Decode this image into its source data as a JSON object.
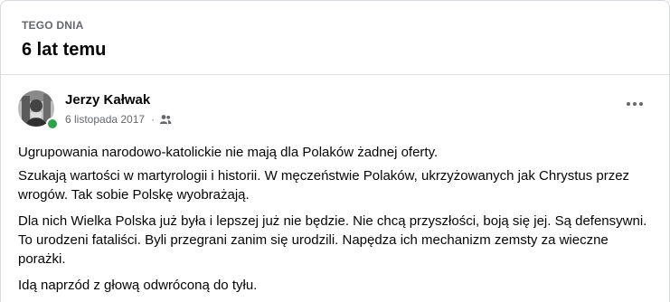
{
  "memory": {
    "kicker": "TEGO DNIA",
    "title": "6 lat temu"
  },
  "post": {
    "author": "Jerzy Kałwak",
    "date": "6 listopada 2017",
    "separator": "·",
    "audience_icon": "friends-icon",
    "more_icon": "more-options-icon",
    "online_color": "#31a24c",
    "paragraphs": [
      "Ugrupowania narodowo-katolickie nie mają dla Polaków żadnej oferty.",
      "Szukają wartości w martyrologii i historii. W męczeństwie Polaków, ukrzyżowanych jak Chrystus przez wrogów. Tak sobie Polskę wyobrażają.",
      "Dla nich Wielka Polska już była i lepszej już nie będzie. Nie chcą przyszłości, boją się jej. Są defensywni. To urodzeni fataliści. Byli przegrani zanim się urodzili. Napędza ich mechanizm zemsty za wieczne porażki.",
      "Idą naprzód z głową odwróconą do tyłu."
    ]
  }
}
